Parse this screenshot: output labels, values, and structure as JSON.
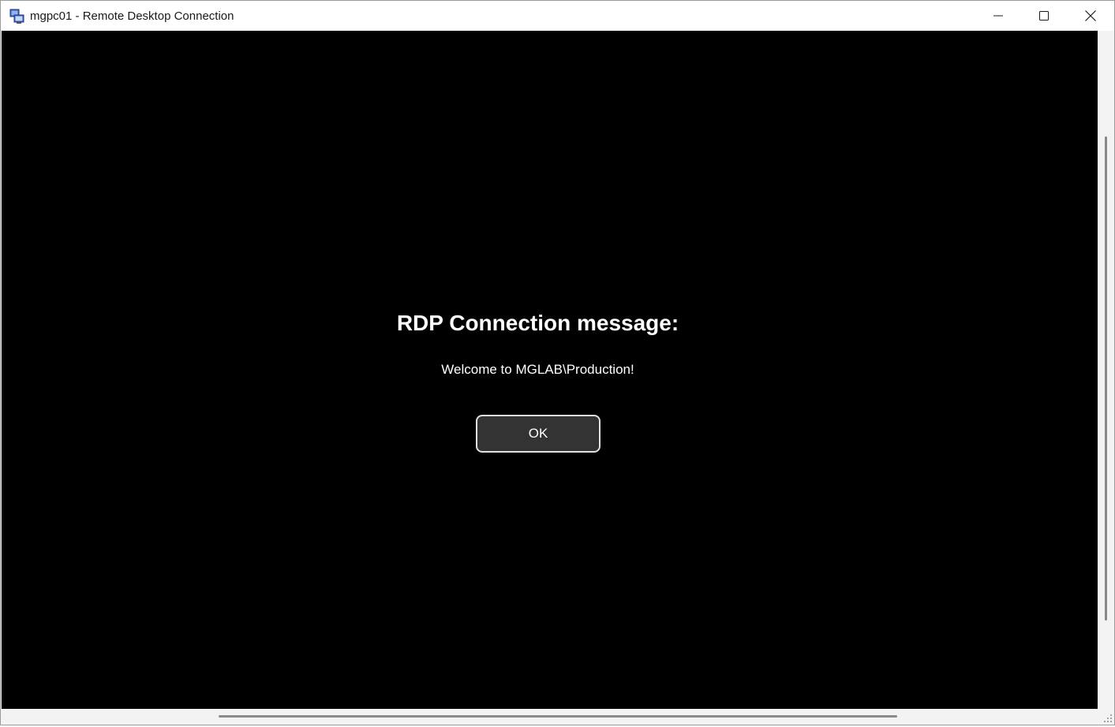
{
  "window": {
    "title": "mgpc01 - Remote Desktop Connection",
    "icon": "remote-desktop-icon"
  },
  "caption_buttons": {
    "minimize_icon": "minimize-icon",
    "maximize_icon": "maximize-icon",
    "close_icon": "close-icon"
  },
  "dialog": {
    "title": "RDP Connection message:",
    "message": "Welcome to MGLAB\\Production!",
    "ok_label": "OK"
  },
  "colors": {
    "session_background": "#000000",
    "button_background": "#333333",
    "button_border": "#e0e0e0",
    "text": "#ffffff"
  }
}
